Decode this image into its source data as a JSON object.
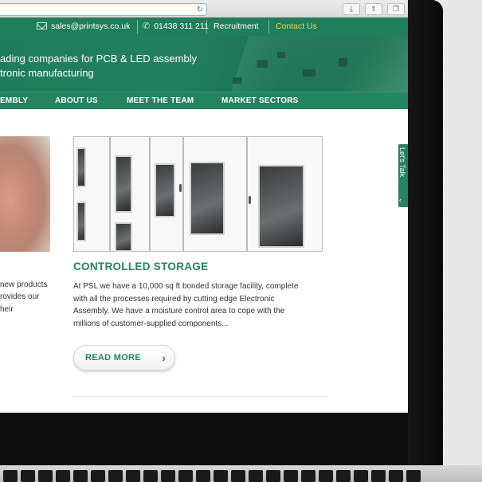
{
  "browser": {
    "url_field": "",
    "toolbar_icons": [
      "reload-icon",
      "download-icon",
      "share-icon",
      "tabs-icon"
    ]
  },
  "topbar": {
    "email": "sales@printsys.co.uk",
    "phone": "01438 311 211",
    "recruitment": "Recruitment",
    "contact": "Contact Us"
  },
  "hero": {
    "line1": "ading companies for PCB & LED assembly",
    "line2": "tronic manufacturing"
  },
  "nav": {
    "items": [
      "EMBLY",
      "ABOUT US",
      "MEET THE TEAM",
      "MARKET SECTORS"
    ]
  },
  "left_card": {
    "lines": [
      "new products",
      "rovides our",
      "heir"
    ]
  },
  "card": {
    "title": "CONTROLLED STORAGE",
    "body_lines": [
      "At PSL we have a 10,000 sq ft bonded storage facility, complete",
      "with all the processes required by cutting edge Electronic",
      "Assembly. We have a moisture control area to cope with the",
      "millions of customer-supplied components..."
    ],
    "button": "READ MORE"
  },
  "talk_tab": {
    "label": "Let's Talk"
  },
  "colors": {
    "brand_green": "#23845f",
    "topbar_green": "#1f7e5c",
    "contact_link": "#f2d64b"
  }
}
